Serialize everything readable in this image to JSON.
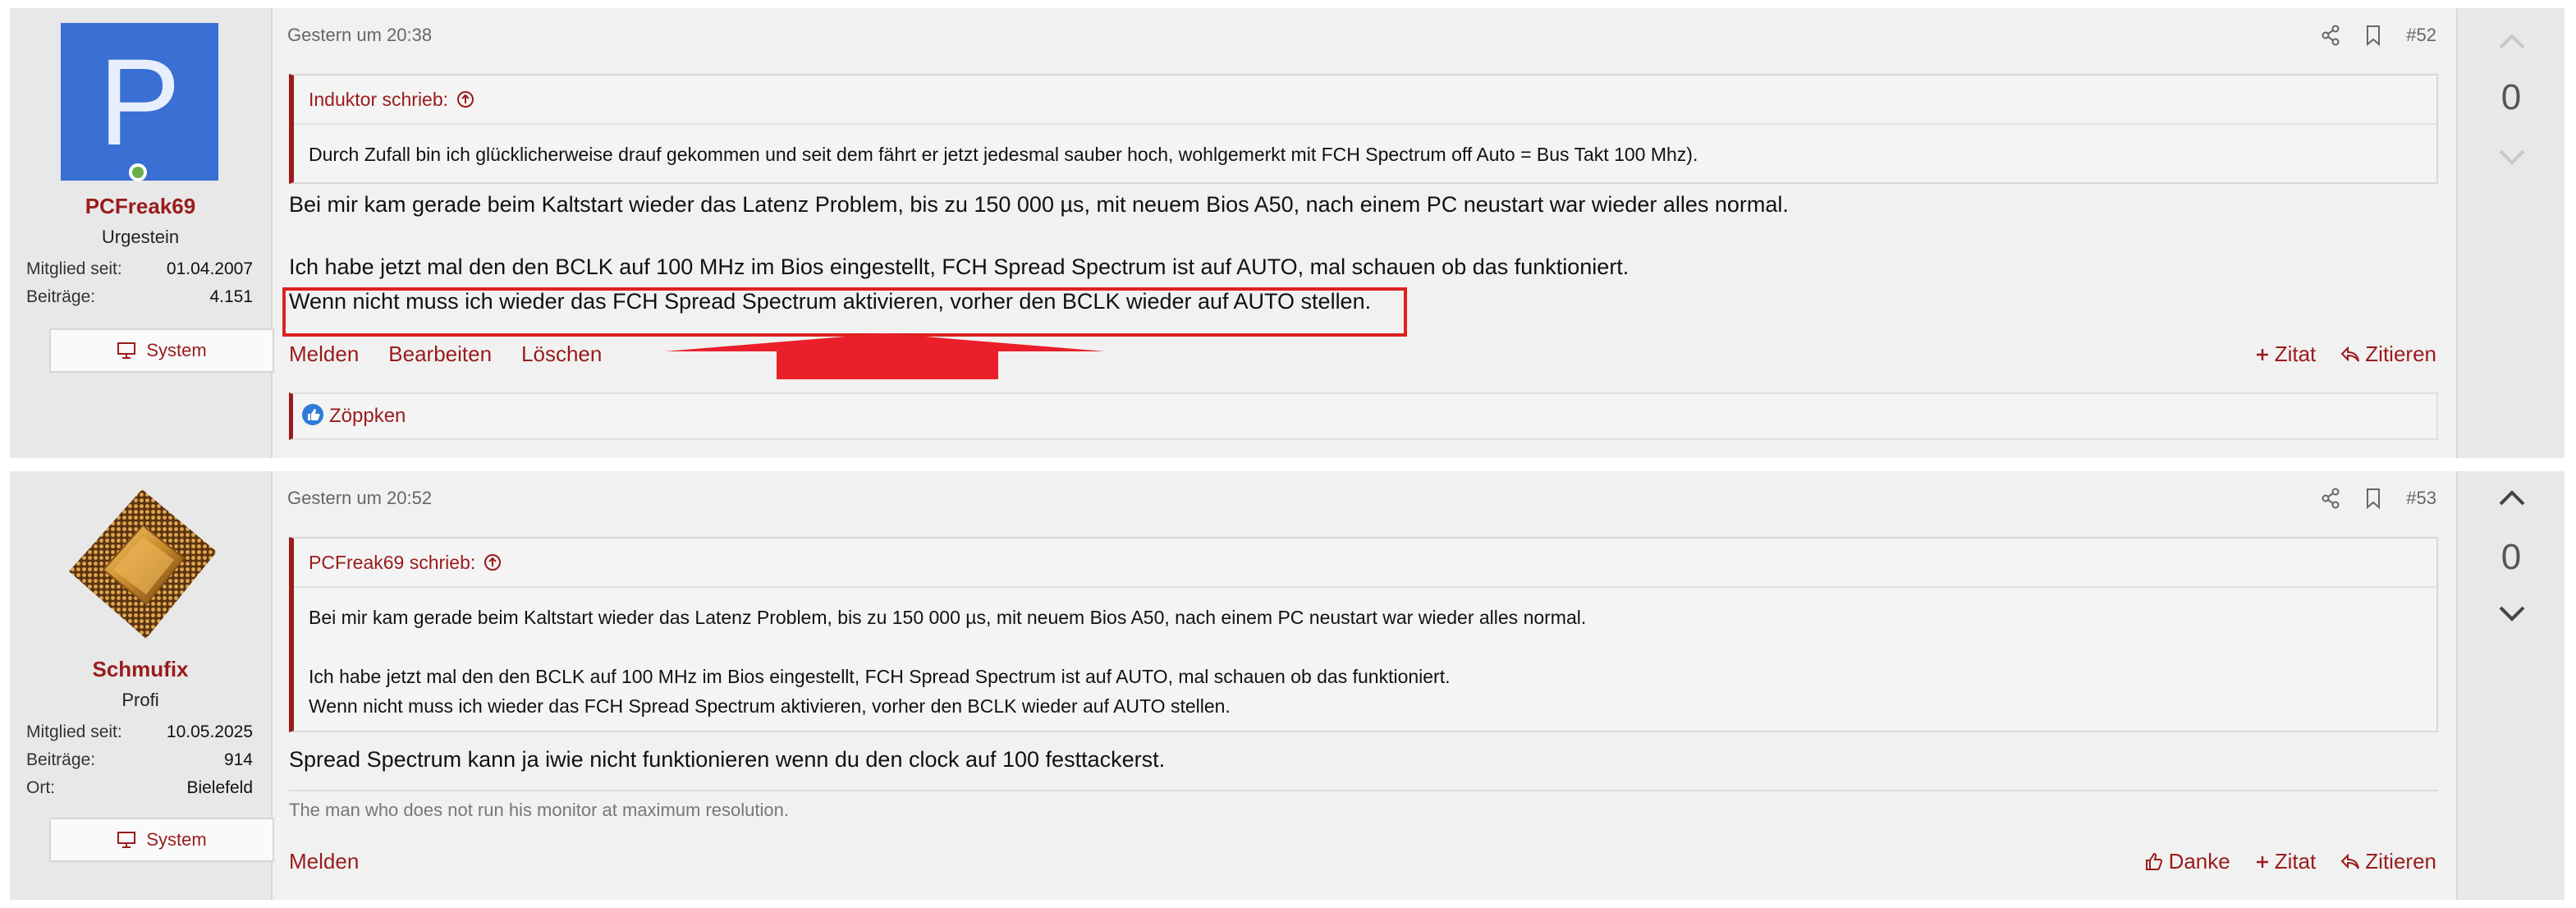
{
  "posts": [
    {
      "user": {
        "avatar_letter": "P",
        "name": "PCFreak69",
        "title": "Urgestein",
        "stats": [
          {
            "k": "Mitglied seit:",
            "v": "01.04.2007"
          },
          {
            "k": "Beiträge:",
            "v": "4.151"
          }
        ],
        "system_label": "System"
      },
      "date": "Gestern um 20:38",
      "post_number": "#52",
      "quote": {
        "author": "Induktor schrieb:",
        "lines": [
          "Durch Zufall bin ich glücklicherweise drauf gekommen und seit dem fährt er jetzt jedesmal sauber hoch, wohlgemerkt mit FCH Spectrum off Auto = Bus Takt 100 Mhz)."
        ]
      },
      "body": [
        "Bei mir kam gerade beim Kaltstart wieder das Latenz Problem, bis zu 150 000 µs, mit neuem Bios A50, nach einem PC neustart war wieder alles normal.",
        "Ich habe jetzt mal den den BCLK auf 100 MHz im Bios eingestellt, FCH Spread Spectrum ist auf AUTO, mal schauen ob das funktioniert.",
        "Wenn nicht muss ich wieder das FCH Spread Spectrum aktivieren, vorher den BCLK wieder auf AUTO stellen."
      ],
      "actions_left": [
        "Melden",
        "Bearbeiten",
        "Löschen"
      ],
      "actions_right": [
        "Zitat",
        "Zitieren"
      ],
      "reaction": "Zöppken",
      "votes": "0"
    },
    {
      "user": {
        "name": "Schmufix",
        "title": "Profi",
        "stats": [
          {
            "k": "Mitglied seit:",
            "v": "10.05.2025"
          },
          {
            "k": "Beiträge:",
            "v": "914"
          },
          {
            "k": "Ort:",
            "v": "Bielefeld"
          }
        ],
        "system_label": "System"
      },
      "date": "Gestern um 20:52",
      "post_number": "#53",
      "quote": {
        "author": "PCFreak69 schrieb:",
        "lines": [
          "Bei mir kam gerade beim Kaltstart wieder das Latenz Problem, bis zu 150 000 µs, mit neuem Bios A50, nach einem PC neustart war wieder alles normal.",
          "Ich habe jetzt mal den den BCLK auf 100 MHz im Bios eingestellt, FCH Spread Spectrum ist auf AUTO, mal schauen ob das funktioniert.",
          "Wenn nicht muss ich wieder das FCH Spread Spectrum aktivieren, vorher den BCLK wieder auf AUTO stellen."
        ]
      },
      "body": [
        "Spread Spectrum kann ja iwie nicht funktionieren wenn du den clock auf 100 festtackerst."
      ],
      "signature": "The man who does not run his monitor at maximum resolution.",
      "actions_left": [
        "Melden"
      ],
      "actions_right": [
        "Danke",
        "Zitat",
        "Zitieren"
      ],
      "votes": "0"
    }
  ],
  "colors": {
    "accent": "#9a1b1b",
    "avatar_bg": "#3a6fd4",
    "annotation": "#e02020"
  },
  "icons": [
    "share-icon",
    "bookmark-icon",
    "arrow-up-circle-icon",
    "monitor-icon",
    "plus-icon",
    "reply-icon",
    "thumbs-up-icon",
    "chevron-up-icon",
    "chevron-down-icon"
  ]
}
